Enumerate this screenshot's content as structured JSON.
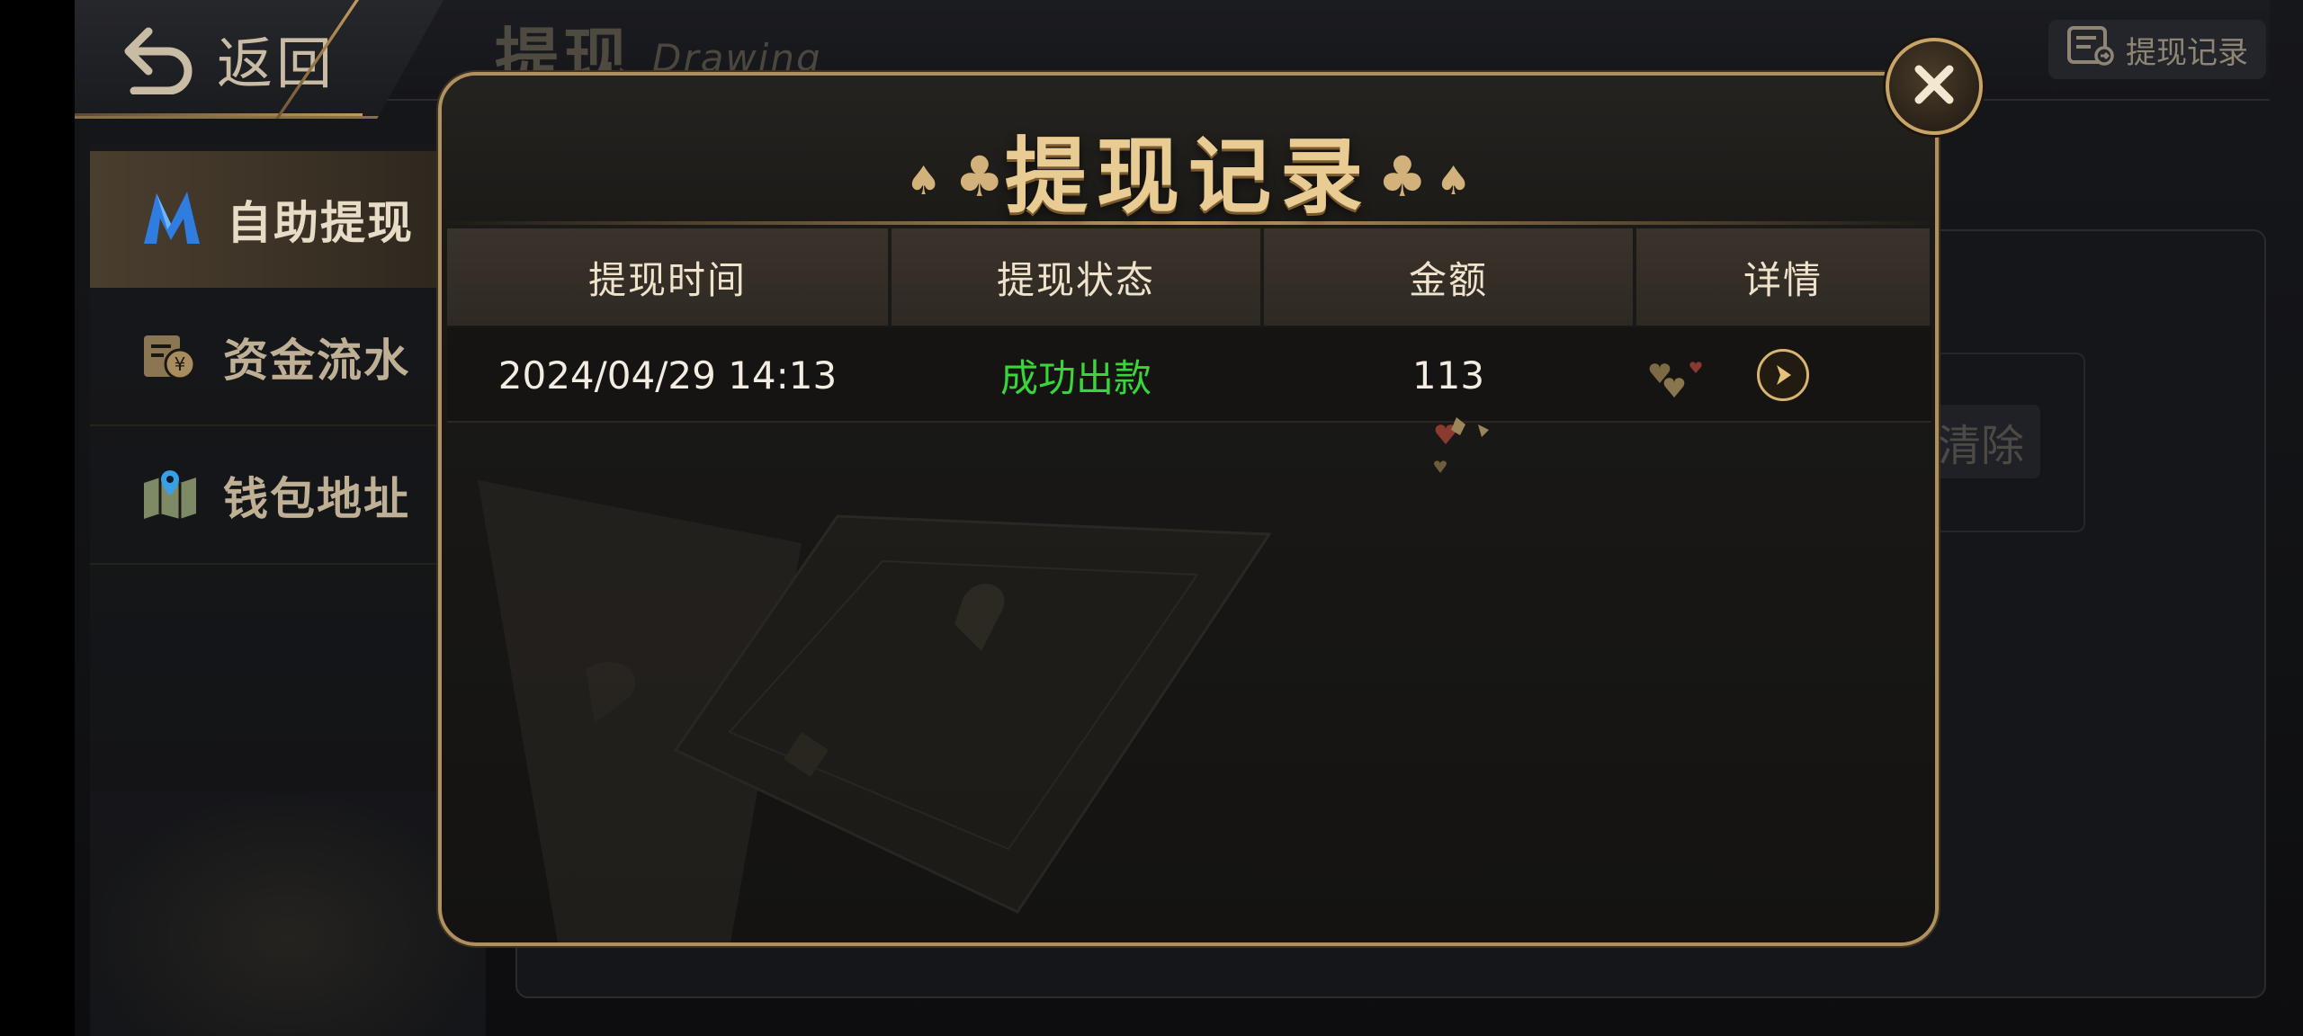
{
  "header": {
    "back_label": "返回",
    "page_title": "提现",
    "page_subtitle": "Drawing",
    "records_button_label": "提现记录"
  },
  "sidebar": {
    "items": [
      {
        "label": "自助提现",
        "icon": "brand-m-icon",
        "active": true
      },
      {
        "label": "资金流水",
        "icon": "wallet-yen-icon",
        "active": false
      },
      {
        "label": "钱包地址",
        "icon": "map-pin-icon",
        "active": false
      }
    ]
  },
  "background": {
    "clear_label": "清除"
  },
  "modal": {
    "title": "提现记录",
    "columns": [
      "提现时间",
      "提现状态",
      "金额",
      "详情"
    ],
    "rows": [
      {
        "time": "2024/04/29 14:13",
        "status": "成功出款",
        "amount": "113",
        "detail_icon": "arrow-right-circle-icon"
      }
    ]
  },
  "colors": {
    "accent_gold": "#c49a5c",
    "status_success": "#38d63a",
    "text_primary": "#f2ece2"
  }
}
